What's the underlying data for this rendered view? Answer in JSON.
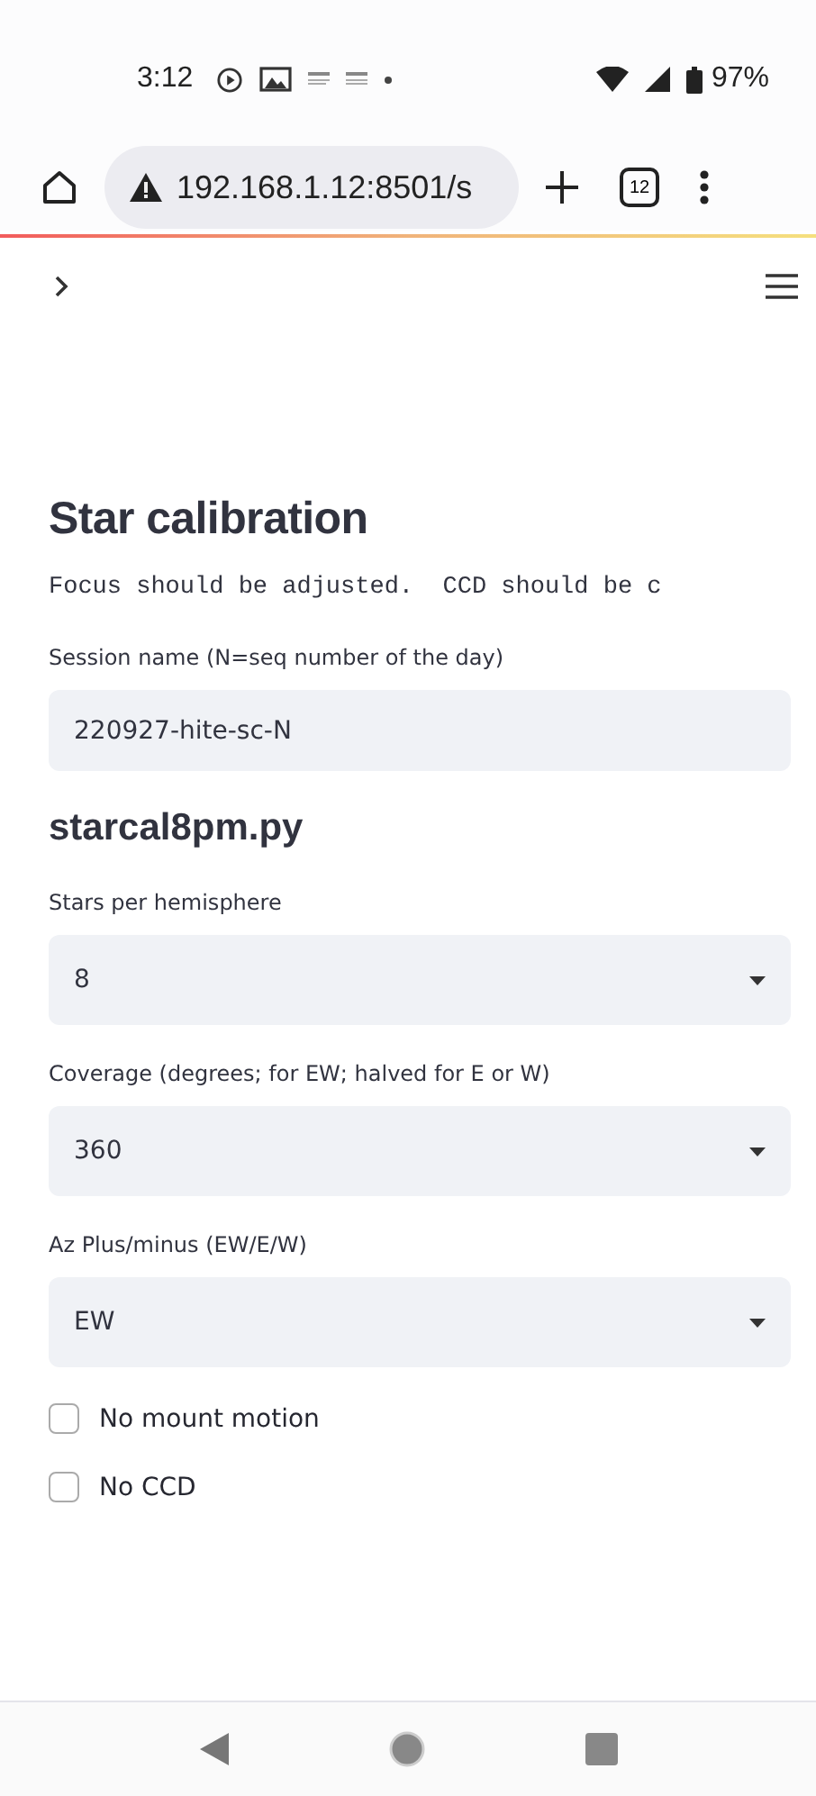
{
  "status_bar": {
    "time": "3:12",
    "battery": "97%"
  },
  "browser": {
    "url": "192.168.1.12:8501/s",
    "tab_count": "12"
  },
  "title": "Star calibration",
  "note": "Focus should be adjusted.  CCD should be c",
  "session": {
    "label": "Session name (N=seq number of the day)",
    "value": "220927-hite-sc-N"
  },
  "section": "starcal8pm.py",
  "selects": [
    {
      "label": "Stars per hemisphere",
      "value": "8"
    },
    {
      "label": "Coverage (degrees; for EW; halved for E or W)",
      "value": "360"
    },
    {
      "label": "Az Plus/minus (EW/E/W)",
      "value": "EW"
    }
  ],
  "checkboxes": [
    {
      "label": "No mount motion",
      "checked": false
    },
    {
      "label": "No CCD",
      "checked": false
    }
  ]
}
